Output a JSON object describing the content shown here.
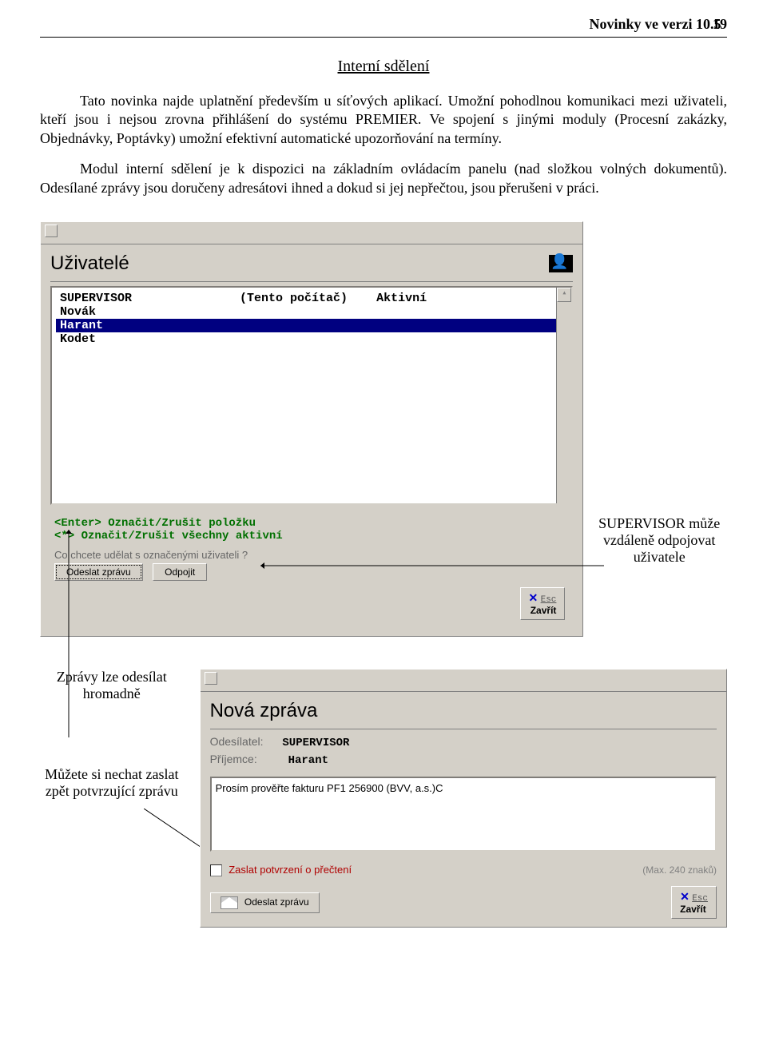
{
  "header": "Novinky ve verzi 10.5",
  "pageno": "19",
  "title": "Interní sdělení",
  "para1": "Tato novinka najde uplatnění především u síťových aplikací. Umožní pohodlnou komunikaci mezi uživateli, kteří jsou i nejsou zrovna přihlášení do systému PREMIER. Ve spojení s jinými moduly (Procesní zakázky, Objednávky, Poptávky) umožní efektivní automatické upozorňování na termíny.",
  "para2": "Modul interní sdělení je k dispozici na základním ovládacím panelu (nad složkou volných dokumentů). Odesílané zprávy jsou doručeny adresátovi ihned a dokud si jej nepřečtou, jsou přerušeni v práci.",
  "users": {
    "title": "Uživatelé",
    "list": {
      "row0": "SUPERVISOR               (Tento počítač)    Aktivní",
      "row1": "Novák",
      "row2": "Harant",
      "row3": "Kodet"
    },
    "hint1": "<Enter> Označit/Zrušit položku",
    "hint2": "<*> Označit/Zrušit všechny aktivní",
    "prompt": "Co chcete udělat s označenými uživateli ?",
    "btn_send": "Odeslat zprávu",
    "btn_disconnect": "Odpojit",
    "esc": "Esc",
    "close": "Zavřít"
  },
  "ann1": "SUPERVISOR může vzdáleně odpojovat uživatele",
  "ann2": "Zprávy lze odesílat hromadně",
  "ann3": "Můžete si nechat zaslat zpět potvrzující zprávu",
  "compose": {
    "title": "Nová zpráva",
    "sender_label": "Odesílatel:",
    "sender": "SUPERVISOR",
    "recipient_label": "Příjemce:",
    "recipient": "Harant",
    "body": "Prosím prověřte fakturu PF1 256900 (BVV, a.s.)C",
    "confirm": "Zaslat potvrzení o přečtení",
    "max": "(Max. 240 znaků)",
    "send": "Odeslat zprávu",
    "esc": "Esc",
    "close": "Zavřít"
  }
}
